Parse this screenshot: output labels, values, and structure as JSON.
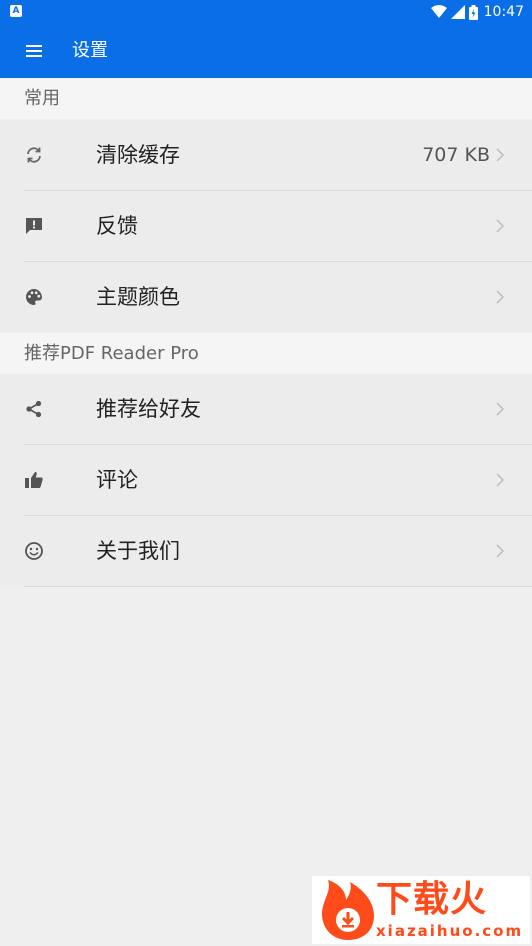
{
  "status_bar": {
    "notification_icon": "A",
    "time": "10:47",
    "icons": [
      "wifi-icon",
      "signal-icon",
      "battery-icon"
    ]
  },
  "app_bar": {
    "title": "设置",
    "color": "#0a6fe6"
  },
  "sections": [
    {
      "header": "常用",
      "items": [
        {
          "label": "清除缓存",
          "value": "707 KB",
          "icon": "sync-icon"
        },
        {
          "label": "反馈",
          "icon": "feedback-icon"
        },
        {
          "label": "主题颜色",
          "icon": "palette-icon"
        }
      ]
    },
    {
      "header": "推荐PDF Reader Pro",
      "items": [
        {
          "label": "推荐给好友",
          "icon": "share-icon"
        },
        {
          "label": "评论",
          "icon": "thumbs-up-icon"
        },
        {
          "label": "关于我们",
          "icon": "smiley-icon"
        }
      ]
    }
  ],
  "watermark": {
    "text": "下载火",
    "url": "xiazaihuo.com"
  }
}
